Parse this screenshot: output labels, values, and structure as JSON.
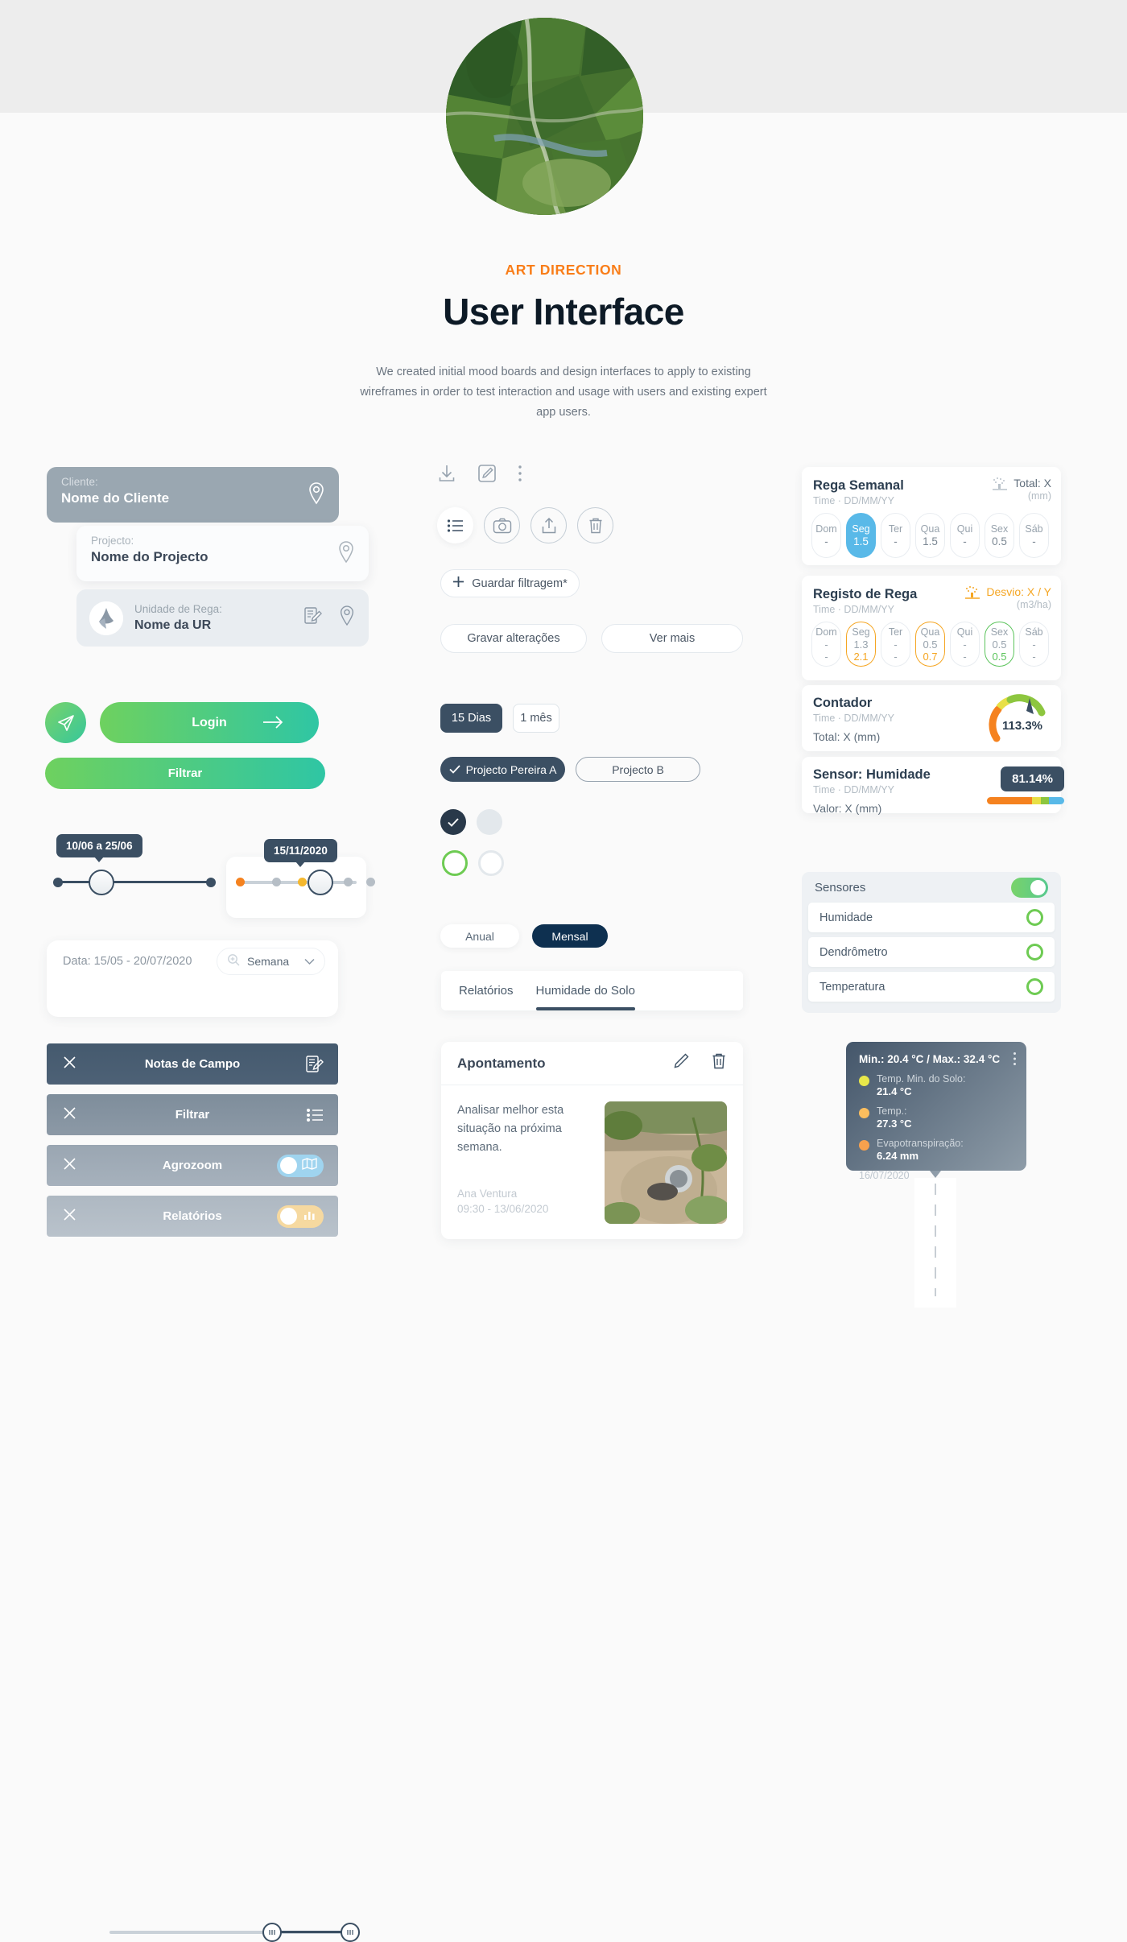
{
  "header": {
    "eyebrow": "ART DIRECTION",
    "title": "User Interface",
    "lede": "We created initial mood boards and design interfaces to apply to existing wireframes in order to test interaction and usage with users and existing expert app users."
  },
  "left": {
    "client": {
      "label": "Cliente:",
      "value": "Nome do Cliente"
    },
    "project": {
      "label": "Projecto:",
      "value": "Nome do Projecto"
    },
    "ur": {
      "label": "Unidade de Rega:",
      "value": "Nome da UR"
    },
    "login_label": "Login",
    "filtrar_label": "Filtrar",
    "slider1_tooltip": "10/06 a 25/06",
    "slider2_tooltip": "15/11/2020",
    "date_text": "Data: 15/05 - 20/07/2020",
    "period_select": "Semana",
    "menu": [
      {
        "label": "Notas de Campo",
        "icon": "note-edit-icon",
        "toggle": null
      },
      {
        "label": "Filtrar",
        "icon": "filter-list-icon",
        "toggle": null
      },
      {
        "label": "Agrozoom",
        "icon": "map-icon",
        "toggle": "blue"
      },
      {
        "label": "Relatórios",
        "icon": "bar-chart-icon",
        "toggle": "amber"
      }
    ]
  },
  "center": {
    "icons_row1": [
      "download-icon",
      "edit-square-icon",
      "kebab-menu-icon"
    ],
    "icons_row2": [
      "list-icon",
      "camera-icon",
      "share-upload-icon",
      "trash-icon"
    ],
    "guardar_label": "Guardar filtragem*",
    "gravar_label": "Gravar alterações",
    "vermais_label": "Ver mais",
    "seg_days": [
      {
        "label": "15 Dias",
        "active": true
      },
      {
        "label": "1 mês",
        "active": false
      }
    ],
    "project_chips": [
      {
        "label": "Projecto Pereira A",
        "active": true
      },
      {
        "label": "Projecto B",
        "active": false
      }
    ],
    "period_toggle": [
      {
        "label": "Anual",
        "active": false
      },
      {
        "label": "Mensal",
        "active": true
      }
    ],
    "tabs": [
      {
        "label": "Relatórios",
        "active": false
      },
      {
        "label": "Humidade do Solo",
        "active": true
      }
    ],
    "apontamento": {
      "title": "Apontamento",
      "text": "Analisar melhor esta situação na próxima semana.",
      "author": "Ana Ventura",
      "timestamp": "09:30 - 13/06/2020"
    }
  },
  "right": {
    "rega_semanal": {
      "title": "Rega Semanal",
      "subtitle": "Time · DD/MM/YY",
      "metric_label": "Total: X",
      "metric_unit": "(mm)",
      "days": [
        {
          "day": "Dom",
          "value": "-",
          "state": "plain"
        },
        {
          "day": "Seg",
          "value": "1.5",
          "state": "selected"
        },
        {
          "day": "Ter",
          "value": "-",
          "state": "plain"
        },
        {
          "day": "Qua",
          "value": "1.5",
          "state": "plain"
        },
        {
          "day": "Qui",
          "value": "-",
          "state": "plain"
        },
        {
          "day": "Sex",
          "value": "0.5",
          "state": "plain"
        },
        {
          "day": "Sáb",
          "value": "-",
          "state": "plain"
        }
      ]
    },
    "registo_rega": {
      "title": "Registo de Rega",
      "subtitle": "Time · DD/MM/YY",
      "metric_label": "Desvio: X / Y",
      "metric_unit": "(m3/ha)",
      "days": [
        {
          "day": "Dom",
          "v1": "-",
          "v2": "-",
          "state": "plain"
        },
        {
          "day": "Seg",
          "v1": "1.3",
          "v2": "2.1",
          "state": "orange"
        },
        {
          "day": "Ter",
          "v1": "-",
          "v2": "-",
          "state": "plain"
        },
        {
          "day": "Qua",
          "v1": "0.5",
          "v2": "0.7",
          "state": "orange"
        },
        {
          "day": "Qui",
          "v1": "-",
          "v2": "-",
          "state": "plain"
        },
        {
          "day": "Sex",
          "v1": "0.5",
          "v2": "0.5",
          "state": "green"
        },
        {
          "day": "Sáb",
          "v1": "-",
          "v2": "-",
          "state": "plain"
        }
      ]
    },
    "contador": {
      "title": "Contador",
      "subtitle": "Time · DD/MM/YY",
      "total": "Total: X (mm)",
      "gauge_value": "113.3%"
    },
    "sensor": {
      "title": "Sensor: Humidade",
      "subtitle": "Time · DD/MM/YY",
      "value_label": "Valor: X (mm)",
      "badge": "81.14%"
    },
    "sensores": {
      "title": "Sensores",
      "items": [
        "Humidade",
        "Dendrômetro",
        "Temperatura"
      ]
    },
    "tooltip": {
      "title": "Min.: 20.4 °C / Max.: 32.4 °C",
      "rows": [
        {
          "label": "Temp. Min. do Solo:",
          "value": "21.4 °C",
          "color": "#e8e84a"
        },
        {
          "label": "Temp.:",
          "value": "27.3 °C",
          "color": "#fcbe5e"
        },
        {
          "label": "Evapotranspiração:",
          "value": "6.24 mm",
          "color": "#f7a14e"
        }
      ],
      "date": "16/07/2020"
    }
  },
  "colors": {
    "accent_orange": "#f97d18",
    "dark": "#3b4f63",
    "green": "#6ecb53",
    "blue": "#59b9e8"
  }
}
